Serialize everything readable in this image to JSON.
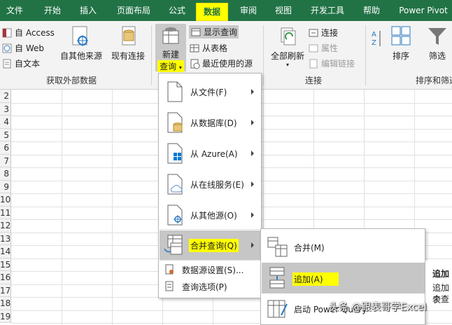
{
  "tabs": [
    "文件",
    "开始",
    "插入",
    "页面布局",
    "公式",
    "数据",
    "审阅",
    "视图",
    "开发工具",
    "帮助",
    "Power Pivot"
  ],
  "active_tab": "数据",
  "ribbon": {
    "get_external": {
      "access": "自 Access",
      "web": "自 Web",
      "text": "自文本",
      "other_sources": "自其他来源",
      "existing_conn": "现有连接",
      "label": "获取外部数据"
    },
    "new_query": {
      "line1": "新建",
      "line2": "查询"
    },
    "show_queries": "显示查询",
    "from_table": "从表格",
    "recent_sources": "最近使用的源",
    "refresh_all": "全部刷新",
    "connections": {
      "conn": "连接",
      "props": "属性",
      "edit_links": "编辑链接",
      "label": "连接"
    },
    "sort": "排序",
    "filter": "筛选",
    "sort_filter_label": "排序和筛选"
  },
  "rows": [
    "2",
    "3",
    "4",
    "5",
    "6",
    "7",
    "8",
    "9",
    "10",
    "11",
    "12",
    "13",
    "14",
    "15",
    "16",
    "17",
    "18",
    "19"
  ],
  "menu": {
    "from_file": "从文件(F)",
    "from_db": "从数据库(D)",
    "from_azure": "从 Azure(A)",
    "from_online": "从在线服务(E)",
    "from_other": "从其他源(O)",
    "combine": "合并查询(Q)",
    "ds_settings": "数据源设置(S)...",
    "query_options": "查询选项(P)"
  },
  "submenu": {
    "merge": "合并(M)",
    "append": "追加(A)",
    "launch": "启动 Power Query"
  },
  "tooltip": [
    "追加",
    "追加表",
    "个查询"
  ],
  "watermark": "头条 @跟表哥学Excel",
  "colors": {
    "excel_green": "#217346",
    "highlight": "#ffff00",
    "hover_gray": "#c6c6c6"
  }
}
